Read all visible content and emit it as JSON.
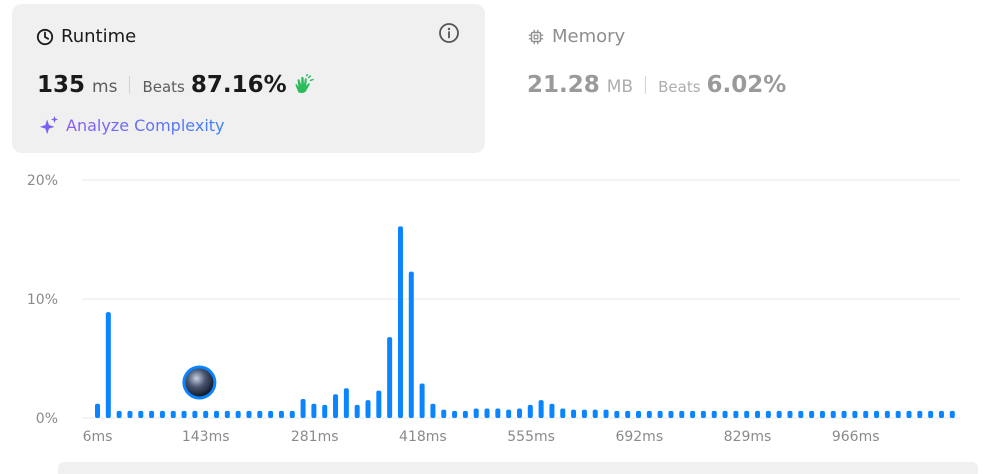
{
  "runtime": {
    "title": "Runtime",
    "value": "135",
    "unit": "ms",
    "beats_label": "Beats",
    "beats_value": "87.16%",
    "analyze_label": "Analyze Complexity"
  },
  "memory": {
    "title": "Memory",
    "value": "21.28",
    "unit": "MB",
    "beats_label": "Beats",
    "beats_value": "6.02%"
  },
  "colors": {
    "bar": "#0a84ff",
    "grid": "#e8e8e8",
    "clap": "#2cbb5d"
  },
  "chart_data": {
    "type": "bar",
    "ylim": [
      0,
      20
    ],
    "yticks": [
      "0%",
      "10%",
      "20%"
    ],
    "ytick_values": [
      0,
      10,
      20
    ],
    "xticks": [
      "6ms",
      "143ms",
      "281ms",
      "418ms",
      "555ms",
      "692ms",
      "829ms",
      "966ms"
    ],
    "x_range": [
      6,
      1103
    ],
    "bar_step_ms": 13.7,
    "values": [
      1.2,
      8.9,
      0.6,
      0.6,
      0.6,
      0.6,
      0.6,
      0.6,
      0.6,
      0.6,
      0.6,
      0.6,
      0.6,
      0.6,
      0.6,
      0.6,
      0.6,
      0.6,
      0.6,
      1.6,
      1.2,
      1.1,
      2.0,
      2.5,
      1.1,
      1.5,
      2.3,
      6.8,
      16.1,
      12.3,
      2.9,
      1.2,
      0.7,
      0.6,
      0.6,
      0.8,
      0.8,
      0.8,
      0.7,
      0.8,
      1.1,
      1.5,
      1.2,
      0.8,
      0.7,
      0.7,
      0.7,
      0.7,
      0.6,
      0.6,
      0.6,
      0.6,
      0.6,
      0.6,
      0.6,
      0.6,
      0.6,
      0.6,
      0.6,
      0.6,
      0.6,
      0.6,
      0.6,
      0.6,
      0.6,
      0.6,
      0.6,
      0.6,
      0.6,
      0.6,
      0.6,
      0.6,
      0.6,
      0.6,
      0.6,
      0.6,
      0.6,
      0.6,
      0.6,
      0.6
    ],
    "marker_x_ms": 135,
    "marker_y": 2.9,
    "grid": true
  }
}
